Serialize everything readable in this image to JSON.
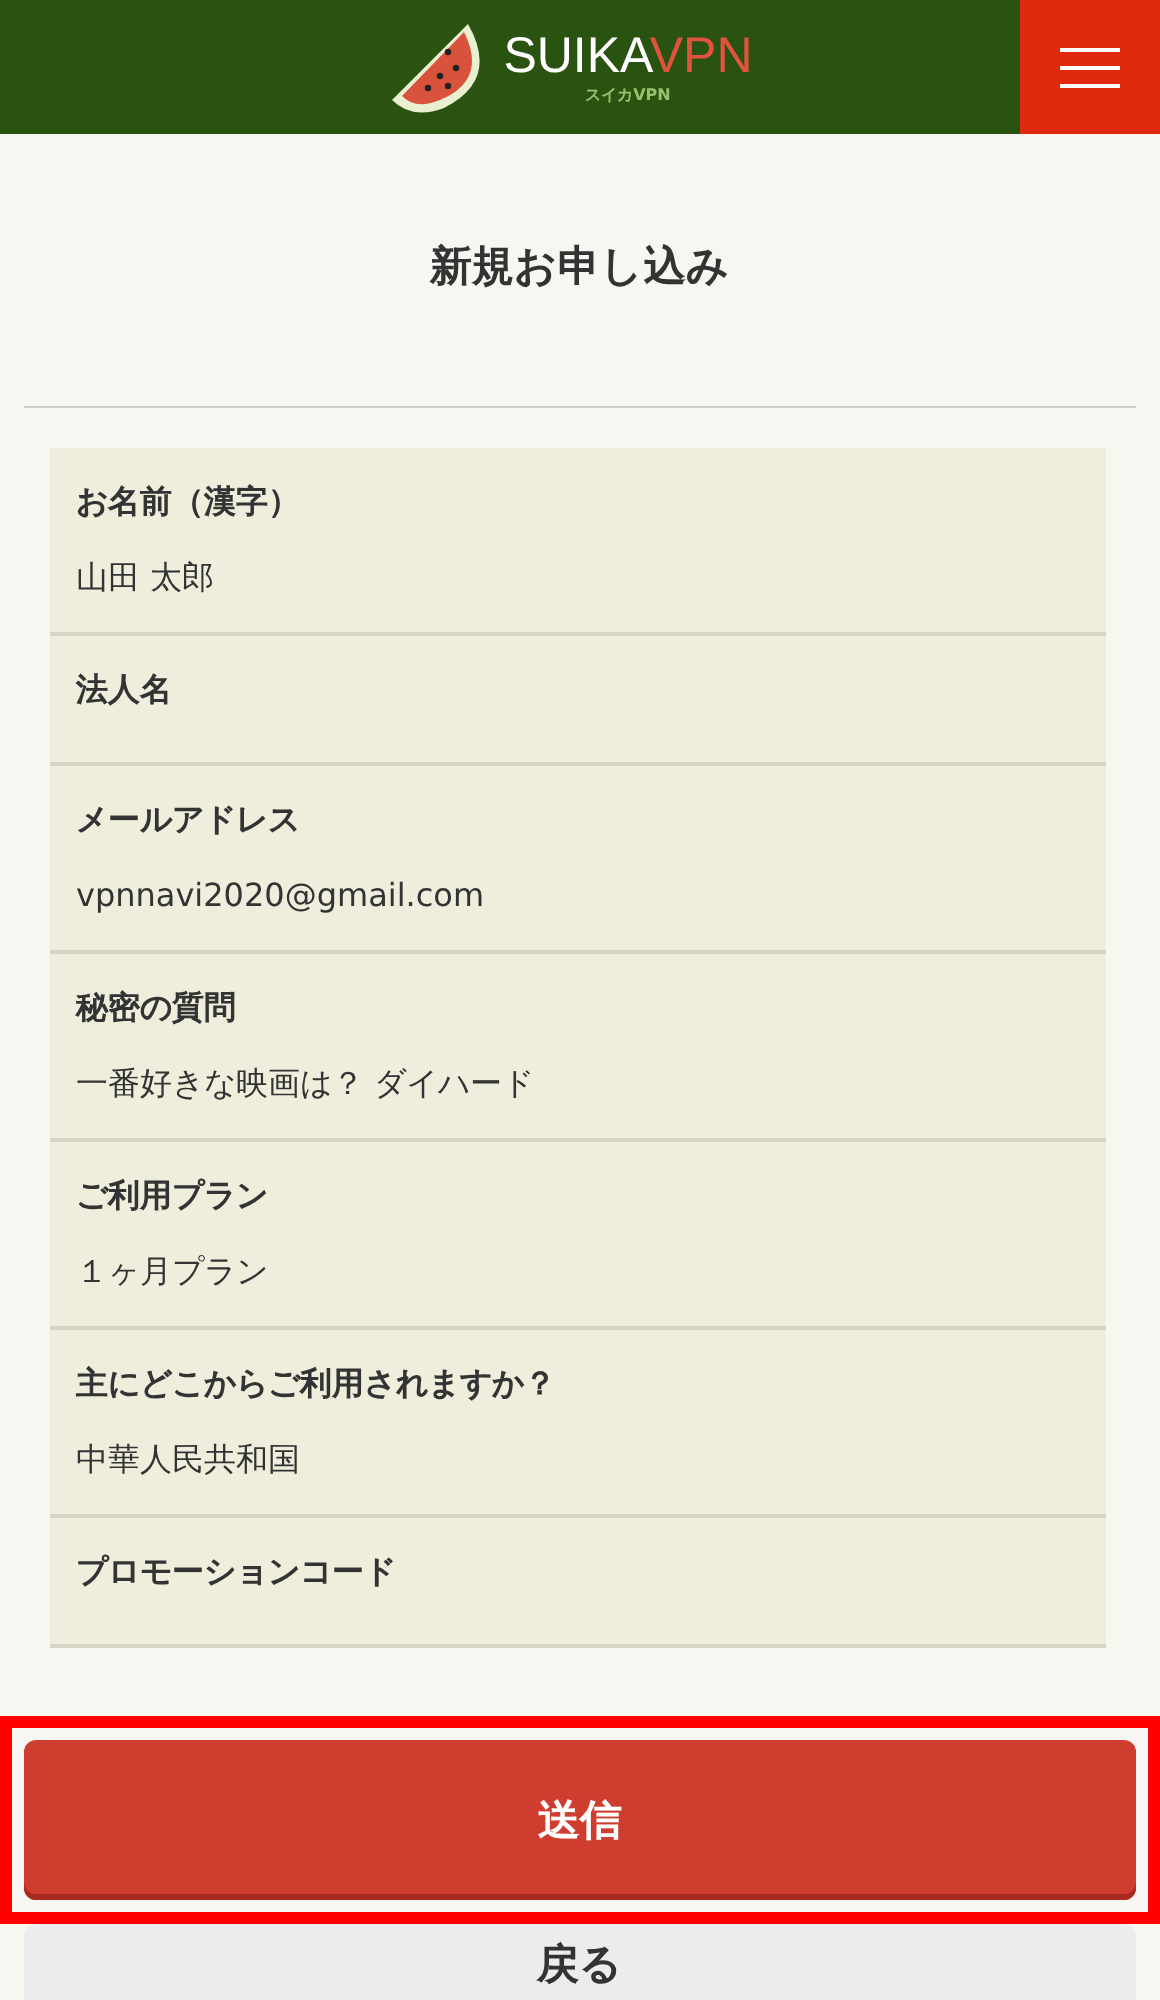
{
  "header": {
    "brand": "SUIKA",
    "brand_accent": "VPN",
    "brand_sub": "スイカVPN"
  },
  "title": "新規お申し込み",
  "fields": [
    {
      "label": "お名前（漢字）",
      "value": "山田 太郎"
    },
    {
      "label": "法人名"
    },
    {
      "label": "メールアドレス",
      "value": "vpnnavi2020@gmail.com"
    },
    {
      "label": "秘密の質問",
      "value": "一番好きな映画は？ ダイハード"
    },
    {
      "label": "ご利用プラン",
      "value": "１ヶ月プラン"
    },
    {
      "label": "主にどこからご利用されますか？",
      "value": "中華人民共和国"
    },
    {
      "label": "プロモーションコード"
    }
  ],
  "buttons": [
    {
      "label": "送信",
      "kind": "primary",
      "highlighted": true
    },
    {
      "label": "戻る",
      "kind": "secondary",
      "highlighted": false
    }
  ]
}
